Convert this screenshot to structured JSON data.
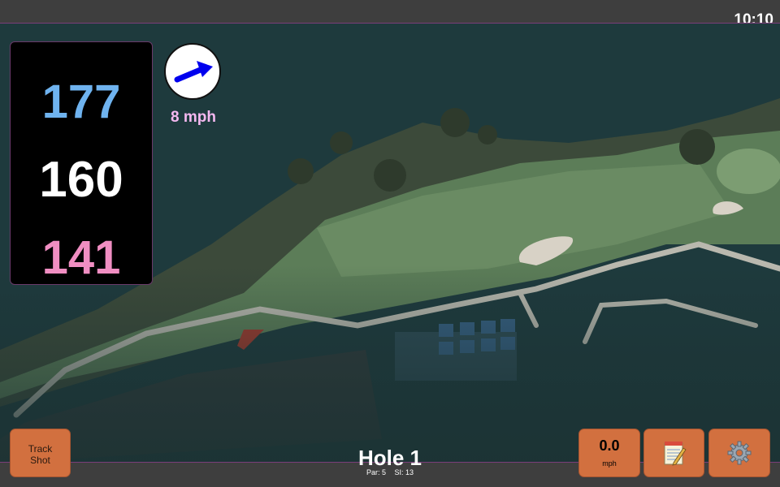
{
  "status_bar": {
    "time": "10:10"
  },
  "distances": {
    "back": "177",
    "middle": "160",
    "front": "141"
  },
  "wind": {
    "speed": "8 mph",
    "direction_icon": "wind-direction-arrow"
  },
  "hole": {
    "title": "Hole 1",
    "par": "Par: 5",
    "stroke_index": "SI: 13"
  },
  "buttons": {
    "track_shot": "Track\nShot",
    "speed_value": "0.0",
    "speed_unit": "mph",
    "notes_icon": "notepad-icon",
    "settings_icon": "gear-icon"
  },
  "colors": {
    "back_distance": "#6fb3ef",
    "middle_distance": "#ffffff",
    "front_distance": "#f08ec2",
    "wind_text": "#f4b8f0",
    "button": "#d2703f"
  }
}
